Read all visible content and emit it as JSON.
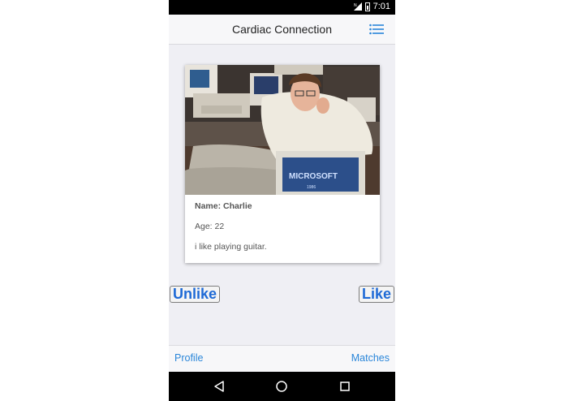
{
  "status_bar": {
    "time": "7:01",
    "network_icon": "signal-icon",
    "battery_icon": "battery-icon"
  },
  "header": {
    "title": "Cardiac Connection",
    "menu_icon": "list-menu-icon"
  },
  "card": {
    "photo_alt": "profile-photo",
    "name_label": "Name: Charlie",
    "age_label": "Age: 22",
    "bio": "i like playing guitar."
  },
  "actions": {
    "unlike_label": "Unlike",
    "like_label": "Like"
  },
  "tabs": {
    "profile_label": "Profile",
    "matches_label": "Matches"
  },
  "navigation": {
    "back_icon": "back-triangle-icon",
    "home_icon": "home-circle-icon",
    "recent_icon": "recent-square-icon"
  },
  "colors": {
    "accent": "#1e6ad6",
    "tab_text": "#2a86d9",
    "background": "#efeff4"
  }
}
